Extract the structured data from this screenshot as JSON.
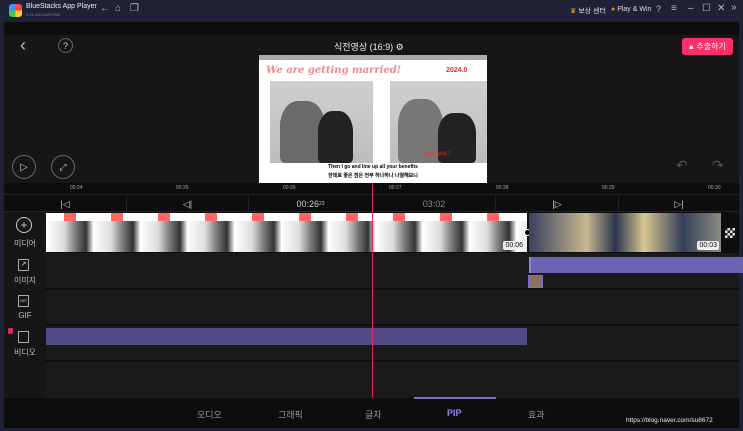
{
  "titlebar": {
    "app_name": "BlueStacks App Player",
    "version": "5.21.210.1020 P64",
    "reward_center": "보상 센터",
    "play_win": "Play & Win"
  },
  "header": {
    "project_title": "식전영상 (16:9)",
    "export_label": "추출하기"
  },
  "preview": {
    "headline": "We are getting married!",
    "date": "2024.0",
    "love_text": "I love you !",
    "subtitle_en": "Then I go and line up all your benefits",
    "subtitle_ko": "한데로 좋은 점은 전부 하나하나 나열해보니"
  },
  "ruler": {
    "ticks": [
      "00:24",
      "00:25",
      "00:26",
      "00:27",
      "00:28",
      "00:29",
      "00:30"
    ]
  },
  "controls": {
    "current_time": "00:26",
    "current_frame": "23",
    "total_time": "03:02"
  },
  "tracks": {
    "media": "미디어",
    "image": "이미지",
    "gif": "GIF",
    "video": "비디오",
    "clip1_duration": "00:06",
    "clip2_duration": "00:03",
    "gif_icon_text": "GIF"
  },
  "tabs": [
    {
      "label": "오디오"
    },
    {
      "label": "그래픽"
    },
    {
      "label": "글자"
    },
    {
      "label": "PIP",
      "active": true
    },
    {
      "label": "효과"
    }
  ],
  "watermark": "https://blog.naver.com/su8672",
  "colors": {
    "accent": "#7b6fd6",
    "playhead": "#e0245e",
    "export": "#ff2d6a",
    "pip_clip": "#6c63b5",
    "video_clip": "#514b87"
  }
}
